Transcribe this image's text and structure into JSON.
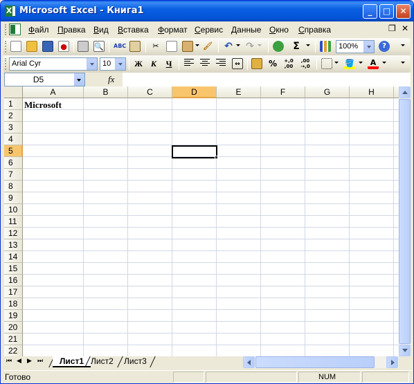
{
  "window": {
    "title": "Microsoft Excel - Книга1",
    "app_icon": "excel-icon",
    "buttons": {
      "minimize": "_",
      "maximize": "□",
      "close": "✕"
    }
  },
  "menubar": {
    "items": [
      "Файл",
      "Правка",
      "Вид",
      "Вставка",
      "Формат",
      "Сервис",
      "Данные",
      "Окно",
      "Справка"
    ],
    "doc_controls": {
      "restore": "❐",
      "close": "✕"
    }
  },
  "standard_toolbar": {
    "icons": [
      "new-icon",
      "open-icon",
      "save-icon",
      "permission-icon",
      "print-icon",
      "print-preview-icon",
      "spelling-icon",
      "research-icon",
      "cut-icon",
      "copy-icon",
      "paste-icon",
      "format-painter-icon",
      "undo-icon",
      "redo-icon",
      "hyperlink-icon",
      "autosum-icon",
      "chart-wizard-icon",
      "help-icon"
    ],
    "autosum": "Σ",
    "zoom": "100%"
  },
  "formatting_toolbar": {
    "font_name": "Arial Cyr",
    "font_size": "10",
    "bold": "Ж",
    "italic": "К",
    "underline": "Ч",
    "percent": "%",
    "inc_decimal": "+,0 ,00",
    "dec_decimal": ",00 →,0",
    "fill_color": "#ffff00",
    "font_color": "#ff0000",
    "font_color_letter": "A"
  },
  "formula_bar": {
    "name_box": "D5",
    "fx_label": "fx",
    "formula": ""
  },
  "sheet": {
    "columns": [
      "A",
      "B",
      "C",
      "D",
      "E",
      "F",
      "G",
      "H"
    ],
    "rows": [
      "1",
      "2",
      "3",
      "4",
      "5",
      "6",
      "7",
      "8",
      "9",
      "10",
      "11",
      "12",
      "13",
      "14",
      "15",
      "16",
      "17",
      "18",
      "19",
      "20",
      "21",
      "22"
    ],
    "active_cell": "D5",
    "cells": {
      "A1": "Microsoft"
    }
  },
  "tabs": {
    "nav": [
      "⏮",
      "◀",
      "▶",
      "⏭"
    ],
    "sheets": [
      "Лист1",
      "Лист2",
      "Лист3"
    ],
    "active": "Лист1"
  },
  "statusbar": {
    "status": "Готово",
    "num": "NUM"
  }
}
